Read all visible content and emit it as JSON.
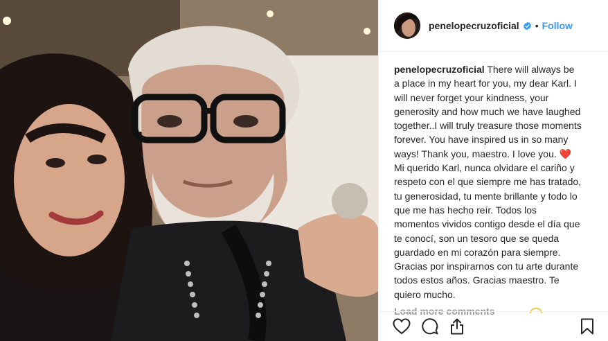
{
  "post": {
    "photo_alt": "",
    "author": {
      "username": "penelopecruzoficial",
      "verified": true,
      "follow_label": "Follow",
      "separator": "•"
    },
    "caption": {
      "username": "penelopecruzoficial",
      "text": "There will always be a place in my heart for you, my dear Karl. I will never forget your kindness, your generosity and how much we have laughed together..I will truly treasure those moments forever. You have inspired us in so many ways! Thank you, maestro. I love you. ❤️ Mi querido Karl, nunca olvidare el cariño y respeto con el que siempre me has tratado, tu generosidad, tu mente brillante y todo lo que me has hecho reír. Todos los momentos vividos contigo desde el día que te conocí, son un tesoro que se queda guardado en mi corazón para siempre. Gracias por inspirarnos con tu arte durante todos estos años. Gracias maestro. Te quiero mucho."
    },
    "load_more_label": "Load more comments",
    "actions": [
      {
        "name": "like",
        "icon": "heart-outline-icon"
      },
      {
        "name": "comment",
        "icon": "comment-bubble-icon"
      },
      {
        "name": "share",
        "icon": "share-upload-icon"
      },
      {
        "name": "save",
        "icon": "bookmark-icon"
      }
    ],
    "colors": {
      "link_blue": "#3897f0",
      "verified_blue": "#3897f0",
      "muted_gray": "#999999",
      "heart_red": "#ed4956",
      "text": "#262626"
    }
  }
}
